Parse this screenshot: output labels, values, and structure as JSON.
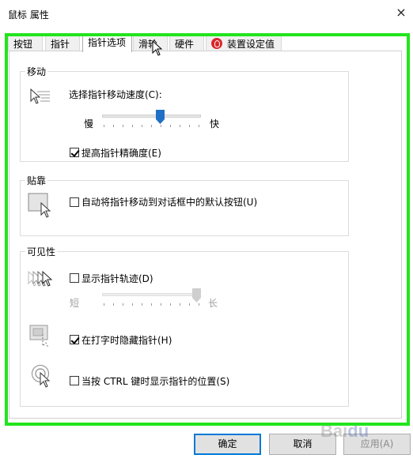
{
  "window": {
    "title": "鼠标 属性",
    "close": "×"
  },
  "tabs": [
    {
      "label": "按钮"
    },
    {
      "label": "指针"
    },
    {
      "label": "指针选项",
      "active": true
    },
    {
      "label": "滑轮"
    },
    {
      "label": "硬件"
    },
    {
      "label": "装置设定值"
    }
  ],
  "motion": {
    "group_label": "移动",
    "speed_label": "选择指针移动速度(C):",
    "slow": "慢",
    "fast": "快",
    "speed_level": 0.6,
    "precision_label": "提高指针精确度(E)",
    "precision_checked": true
  },
  "snap": {
    "group_label": "贴靠",
    "snap_label": "自动将指针移动到对话框中的默认按钮(U)",
    "snap_checked": false
  },
  "visibility": {
    "group_label": "可见性",
    "trails_label": "显示指针轨迹(D)",
    "trails_checked": false,
    "short": "短",
    "long": "长",
    "trail_level": 1.0,
    "hide_label": "在打字时隐藏指针(H)",
    "hide_checked": true,
    "ctrl_label": "当按 CTRL 键时显示指针的位置(S)",
    "ctrl_checked": false
  },
  "buttons": {
    "ok": "确定",
    "cancel": "取消",
    "apply": "应用(A)"
  },
  "watermark": "Baidu",
  "colors": {
    "highlight_frame": "#22e51e",
    "accent": "#0078d7",
    "slider_thumb": "#1f6fc6"
  }
}
